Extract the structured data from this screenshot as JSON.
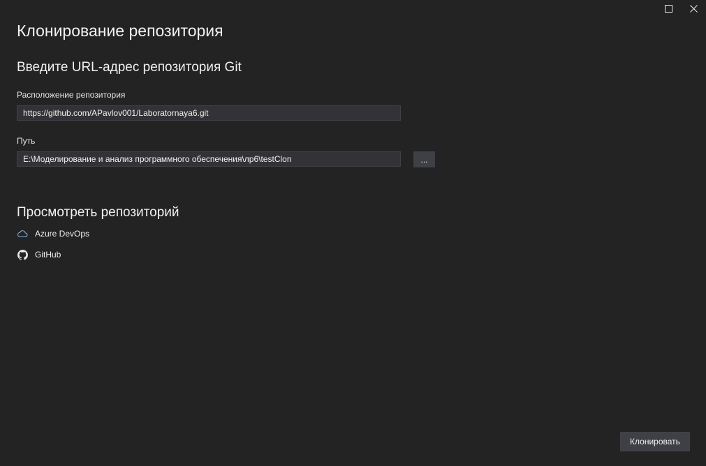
{
  "window": {
    "maximize_icon": "maximize-icon",
    "close_icon": "close-icon"
  },
  "title": "Клонирование репозитория",
  "url_section": {
    "heading": "Введите URL-адрес репозитория Git",
    "location_label": "Расположение репозитория",
    "location_value": "https://github.com/APavlov001/Laboratornaya6.git",
    "path_label": "Путь",
    "path_value": "E:\\Моделирование и анализ программного обеспечения\\лр6\\testClon",
    "browse_label": "..."
  },
  "browse_section": {
    "heading": "Просмотреть репозиторий",
    "items": [
      {
        "label": "Azure DevOps",
        "icon": "cloud-icon"
      },
      {
        "label": "GitHub",
        "icon": "github-icon"
      }
    ]
  },
  "footer": {
    "clone_label": "Клонировать"
  },
  "colors": {
    "background": "#232323",
    "input_background": "#333337",
    "button_background": "#3f3f46",
    "accent_cloud": "#7fb3d5"
  }
}
